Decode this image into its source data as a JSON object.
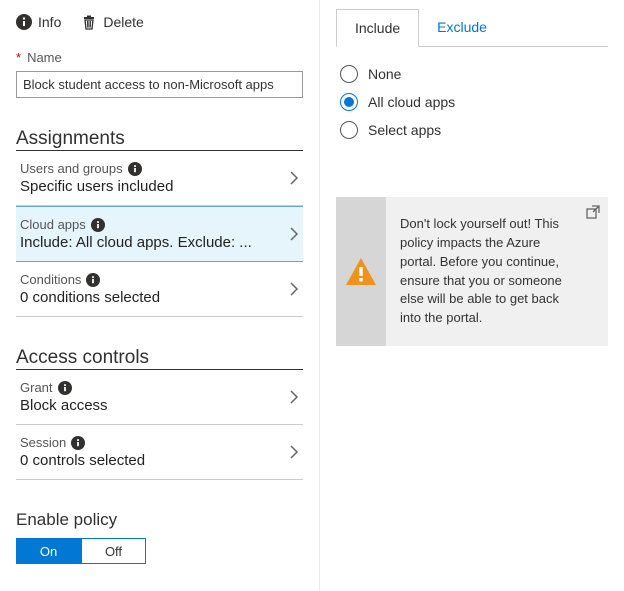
{
  "actions": {
    "info": "Info",
    "delete": "Delete"
  },
  "nameField": {
    "label": "Name",
    "value": "Block student access to non-Microsoft apps"
  },
  "sections": {
    "assignments": {
      "heading": "Assignments",
      "items": [
        {
          "title": "Users and groups",
          "subtitle": "Specific users included"
        },
        {
          "title": "Cloud apps",
          "subtitle": "Include: All cloud apps. Exclude: ..."
        },
        {
          "title": "Conditions",
          "subtitle": "0 conditions selected"
        }
      ]
    },
    "accessControls": {
      "heading": "Access controls",
      "items": [
        {
          "title": "Grant",
          "subtitle": "Block access"
        },
        {
          "title": "Session",
          "subtitle": "0 controls selected"
        }
      ]
    }
  },
  "enablePolicy": {
    "heading": "Enable policy",
    "on": "On",
    "off": "Off",
    "value": "On"
  },
  "rightPanel": {
    "tabs": {
      "include": "Include",
      "exclude": "Exclude",
      "active": "Include"
    },
    "radios": {
      "none": "None",
      "all": "All cloud apps",
      "select": "Select apps",
      "selected": "all"
    },
    "warning": "Don't lock yourself out! This policy impacts the Azure portal. Before you continue, ensure that you or someone else will be able to get back into the portal."
  }
}
